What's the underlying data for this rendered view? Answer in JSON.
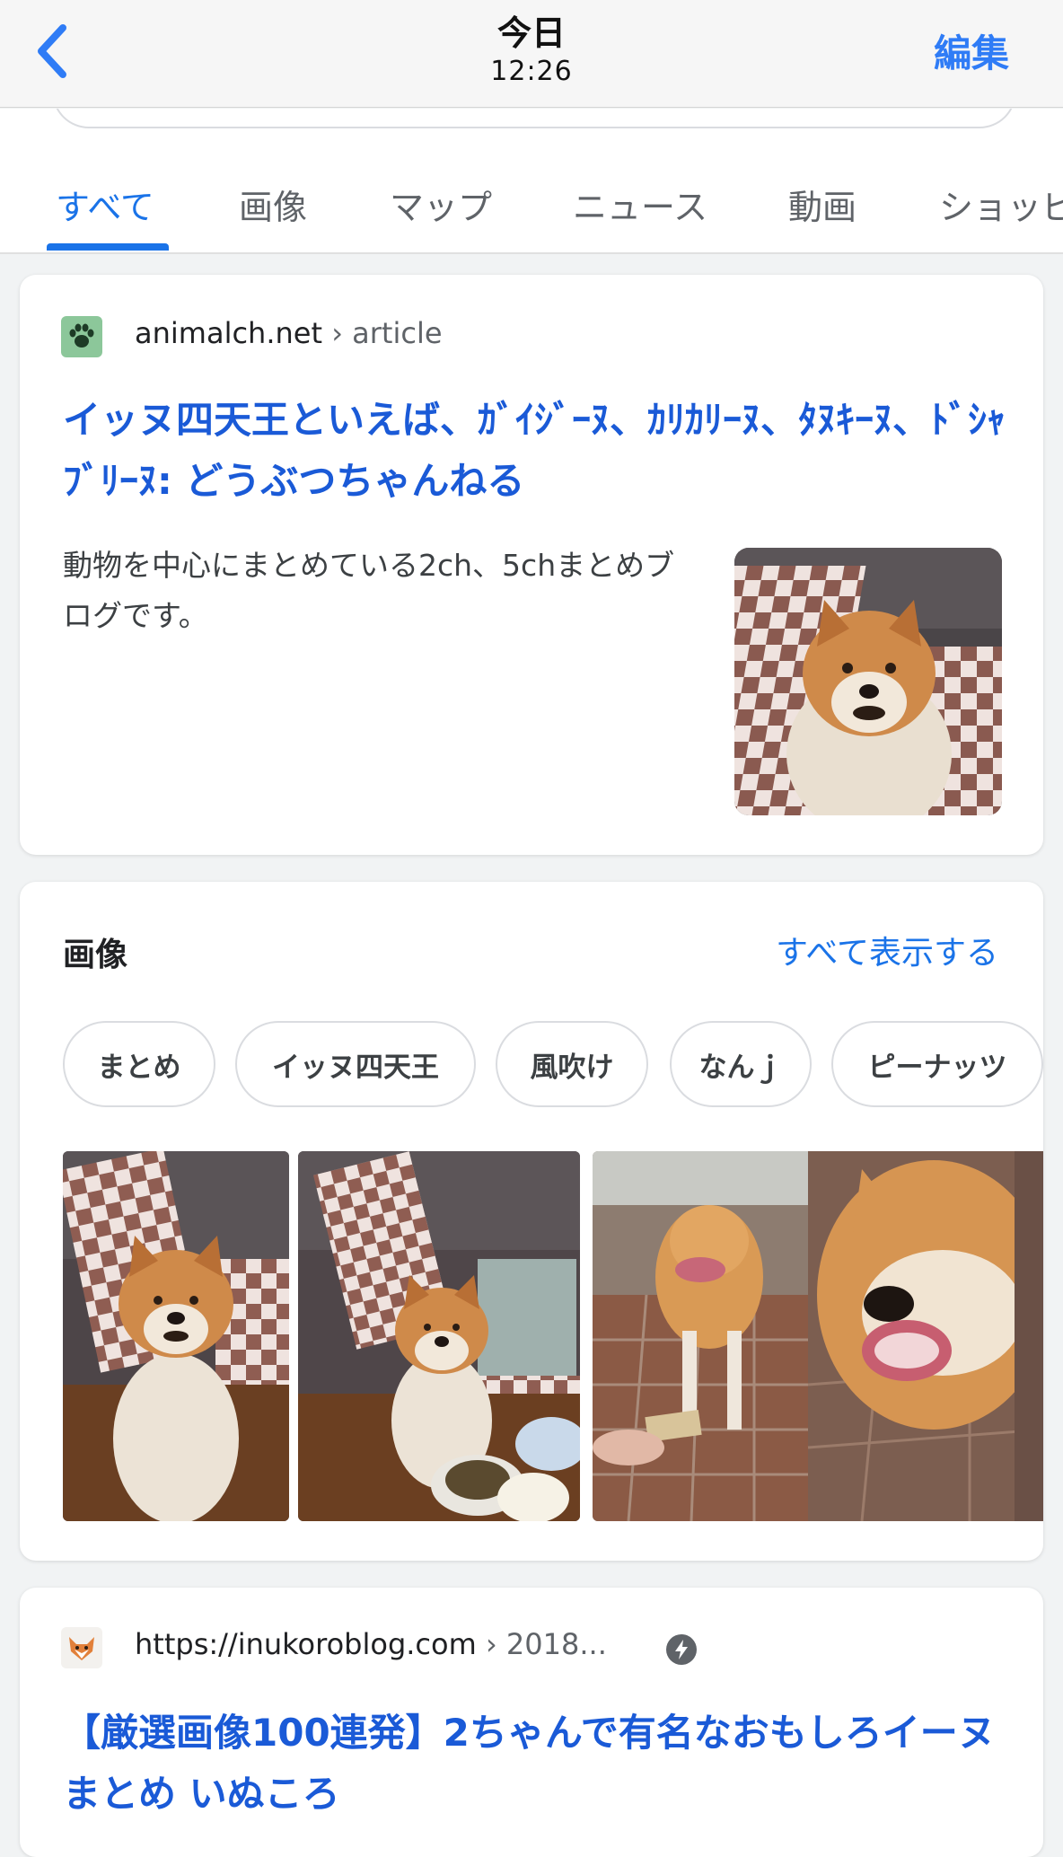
{
  "nav": {
    "title": "今日",
    "subtitle": "12:26",
    "edit_label": "編集"
  },
  "tabs": [
    "すべて",
    "画像",
    "マップ",
    "ニュース",
    "動画",
    "ショッピ"
  ],
  "result1": {
    "domain": "animalch.net",
    "path": " › article",
    "title": "イッヌ四天王といえば、ｶﾞｲｼﾞｰﾇ、ｶﾘｶﾘｰﾇ、ﾀﾇｷｰﾇ、ﾄﾞｼｬﾌﾞﾘｰﾇ: どうぶつちゃんねる",
    "snippet": "動物を中心にまとめている2ch、5chまとめブログです。",
    "favicon": "paw-icon"
  },
  "images_section": {
    "title": "画像",
    "see_all": "すべて表示する",
    "chips": [
      "まとめ",
      "イッヌ四天王",
      "風吹け",
      "なんｊ",
      "ピーナッツ"
    ]
  },
  "result2": {
    "domain": "https://inukoroblog.com",
    "path": " › 2018...",
    "title": "【厳選画像100連発】2ちゃんで有名なおもしろイーヌまとめ いぬころ",
    "favicon": "fox-icon",
    "badge": "amp-lightning-icon"
  },
  "colors": {
    "link_blue": "#1a5ad7",
    "accent_blue": "#1a73e8",
    "ios_blue": "#2f7cf6"
  }
}
